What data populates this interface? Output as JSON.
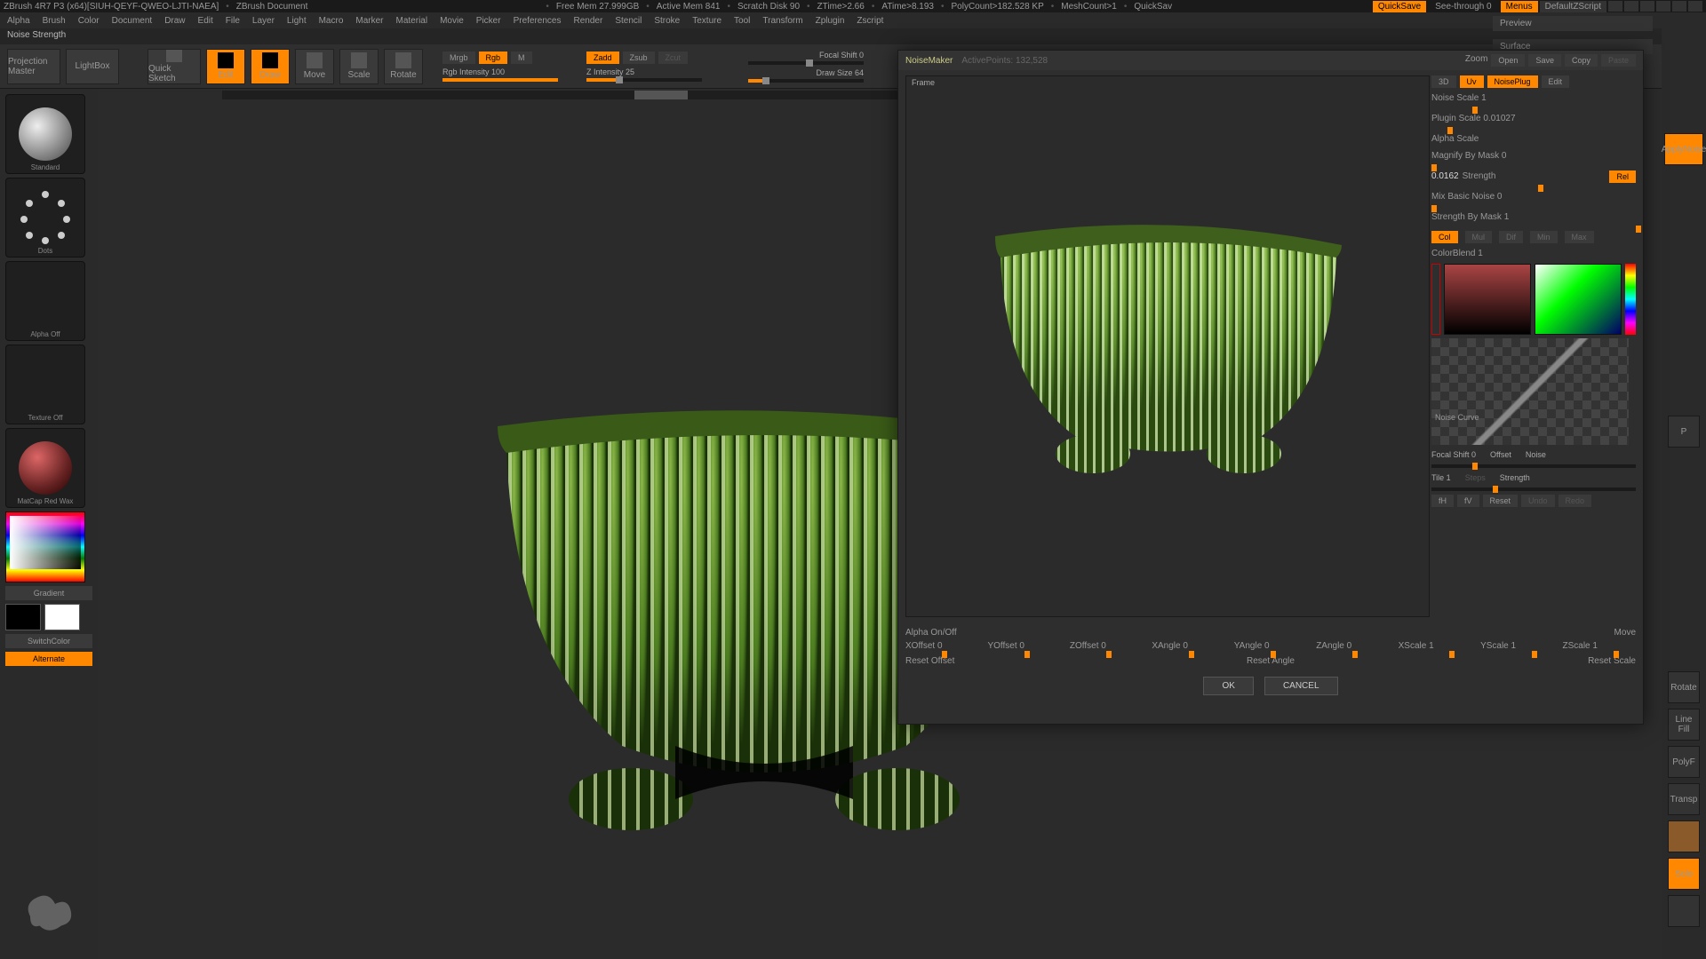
{
  "top": {
    "app": "ZBrush 4R7 P3 (x64)[SIUH-QEYF-QWEO-LJTI-NAEA]",
    "doc": "ZBrush Document",
    "freemem": "Free Mem 27.999GB",
    "activemem": "Active Mem 841",
    "scratch": "Scratch Disk 90",
    "ztime": "ZTime>2.66",
    "atime": "ATime>8.193",
    "poly": "PolyCount>182.528 KP",
    "mesh": "MeshCount>1",
    "quicksave1": "QuickSav",
    "quicksave2": "QuickSave",
    "seethrough": "See-through  0",
    "menus": "Menus",
    "script": "DefaultZScript"
  },
  "menu": [
    "Alpha",
    "Brush",
    "Color",
    "Document",
    "Draw",
    "Edit",
    "File",
    "Layer",
    "Light",
    "Macro",
    "Marker",
    "Material",
    "Movie",
    "Picker",
    "Preferences",
    "Render",
    "Stencil",
    "Stroke",
    "Texture",
    "Tool",
    "Transform",
    "Zplugin",
    "Zscript"
  ],
  "status": "Noise Strength",
  "toolbar": {
    "projection": "Projection Master",
    "lightbox": "LightBox",
    "quicksketch": "Quick Sketch",
    "edit": "Edit",
    "draw": "Draw",
    "move": "Move",
    "scale": "Scale",
    "rotate": "Rotate",
    "mrgb": "Mrgb",
    "rgb": "Rgb",
    "m": "M",
    "rgb_intensity": "Rgb Intensity 100",
    "zadd": "Zadd",
    "zsub": "Zsub",
    "zcut": "Zcut",
    "zintensity": "Z Intensity 25",
    "focal": "Focal Shift 0",
    "drawsize": "Draw Size 64"
  },
  "left": {
    "standard": "Standard",
    "dots": "Dots",
    "alpha": "Alpha Off",
    "texture": "Texture Off",
    "matcap": "MatCap Red Wax",
    "gradient": "Gradient",
    "switch": "SwitchColor",
    "alternate": "Alternate"
  },
  "right": {
    "preview": "Preview",
    "surface": "Surface",
    "applynoise": "ApplyNoise",
    "p": "P",
    "linefill": "Line Fill",
    "polyf": "PolyF",
    "transp": "Transp",
    "solo": "Solo",
    "rotate": "Rotate"
  },
  "nm": {
    "title": "NoiseMaker",
    "activepts": "ActivePoints: 132,528",
    "zoom": "Zoom",
    "open": "Open",
    "save": "Save",
    "copy": "Copy",
    "paste": "Paste",
    "frame": "Frame",
    "3d": "3D",
    "uv": "Uv",
    "noiseplug": "NoisePlug",
    "edit": "Edit",
    "noisescale": "Noise Scale  1",
    "pluginscale": "Plugin Scale  0.01027",
    "alphascale": "Alpha Scale",
    "magnify": "Magnify By Mask 0",
    "strength_val": "0.0162",
    "strength_lbl": "Strength",
    "rel": "Rel",
    "mixbasic": "Mix Basic Noise 0",
    "strengthmask": "Strength By Mask 1",
    "col": "Col",
    "mul": "Mul",
    "dif": "Dif",
    "min": "Min",
    "max": "Max",
    "colorblend": "ColorBlend 1",
    "noisecurve": "Noise Curve",
    "focal2": "Focal Shift 0",
    "offset2": "Offset",
    "noise2": "Noise",
    "tile": "Tile 1",
    "steps": "Steps",
    "strength2": "Strength",
    "fh": "fH",
    "fv": "fV",
    "reset": "Reset",
    "undo": "Undo",
    "redo": "Redo",
    "alphaon": "Alpha On/Off",
    "move": "Move",
    "xoff": "XOffset 0",
    "yoff": "YOffset 0",
    "zoff": "ZOffset 0",
    "xang": "XAngle 0",
    "yang": "YAngle 0",
    "zang": "ZAngle 0",
    "xsc": "XScale 1",
    "ysc": "YScale 1",
    "zsc": "ZScale 1",
    "resetoff": "Reset Offset",
    "resetang": "Reset Angle",
    "resetsc": "Reset Scale",
    "ok": "OK",
    "cancel": "CANCEL"
  }
}
